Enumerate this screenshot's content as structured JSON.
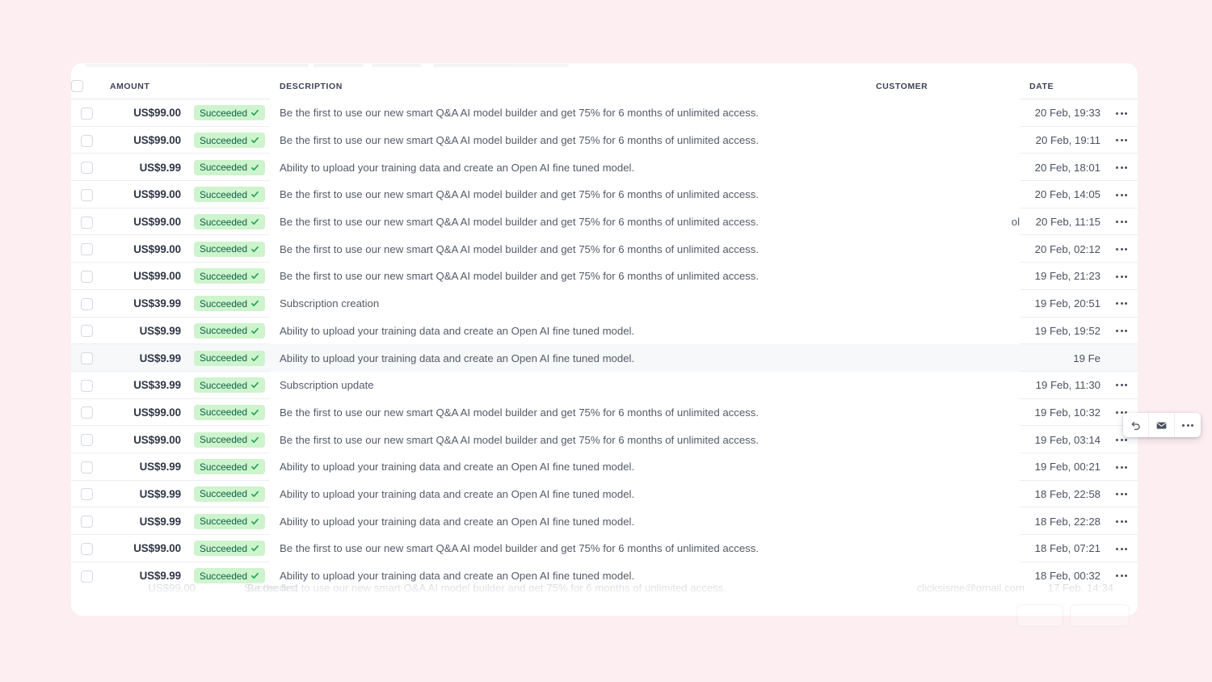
{
  "theme": {
    "page_background": "#fdeef2",
    "card_background": "#ffffff",
    "badge_background": "#cdf4cd",
    "badge_text": "#0e6245",
    "row_hover": "#f6f8f9",
    "divider": "#ebeef1"
  },
  "table": {
    "columns": {
      "select": "",
      "amount": "AMOUNT",
      "status": "",
      "description": "DESCRIPTION",
      "customer": "CUSTOMER",
      "date": "DATE",
      "actions": ""
    },
    "status_label": "Succeeded",
    "rows": [
      {
        "amount": "US$99.00",
        "status": "Succeeded",
        "description": "Be the first to use our new smart Q&A AI model builder and get 75% for 6 months of unlimited access.",
        "customer": "",
        "date": "20 Feb, 19:33",
        "hover": false
      },
      {
        "amount": "US$99.00",
        "status": "Succeeded",
        "description": "Be the first to use our new smart Q&A AI model builder and get 75% for 6 months of unlimited access.",
        "customer": "",
        "date": "20 Feb, 19:11",
        "hover": false
      },
      {
        "amount": "US$9.99",
        "status": "Succeeded",
        "description": "Ability to upload your training data and create an Open AI fine tuned model.",
        "customer": "",
        "date": "20 Feb, 18:01",
        "hover": false
      },
      {
        "amount": "US$99.00",
        "status": "Succeeded",
        "description": "Be the first to use our new smart Q&A AI model builder and get 75% for 6 months of unlimited access.",
        "customer": "",
        "date": "20 Feb, 14:05",
        "hover": false
      },
      {
        "amount": "US$99.00",
        "status": "Succeeded",
        "description": "Be the first to use our new smart Q&A AI model builder and get 75% for 6 months of unlimited access.",
        "customer": "ol",
        "date": "20 Feb, 11:15",
        "hover": false
      },
      {
        "amount": "US$99.00",
        "status": "Succeeded",
        "description": "Be the first to use our new smart Q&A AI model builder and get 75% for 6 months of unlimited access.",
        "customer": "",
        "date": "20 Feb, 02:12",
        "hover": false
      },
      {
        "amount": "US$99.00",
        "status": "Succeeded",
        "description": "Be the first to use our new smart Q&A AI model builder and get 75% for 6 months of unlimited access.",
        "customer": "",
        "date": "19 Feb, 21:23",
        "hover": false
      },
      {
        "amount": "US$39.99",
        "status": "Succeeded",
        "description": "Subscription creation",
        "customer": "",
        "date": "19 Feb, 20:51",
        "hover": false
      },
      {
        "amount": "US$9.99",
        "status": "Succeeded",
        "description": "Ability to upload your training data and create an Open AI fine tuned model.",
        "customer": "",
        "date": "19 Feb, 19:52",
        "hover": false
      },
      {
        "amount": "US$9.99",
        "status": "Succeeded",
        "description": "Ability to upload your training data and create an Open AI fine tuned model.",
        "customer": "",
        "date": "19 Fe",
        "hover": true
      },
      {
        "amount": "US$39.99",
        "status": "Succeeded",
        "description": "Subscription update",
        "customer": "",
        "date": "19 Feb, 11:30",
        "hover": false
      },
      {
        "amount": "US$99.00",
        "status": "Succeeded",
        "description": "Be the first to use our new smart Q&A AI model builder and get 75% for 6 months of unlimited access.",
        "customer": "",
        "date": "19 Feb, 10:32",
        "hover": false
      },
      {
        "amount": "US$99.00",
        "status": "Succeeded",
        "description": "Be the first to use our new smart Q&A AI model builder and get 75% for 6 months of unlimited access.",
        "customer": "",
        "date": "19 Feb, 03:14",
        "hover": false
      },
      {
        "amount": "US$9.99",
        "status": "Succeeded",
        "description": "Ability to upload your training data and create an Open AI fine tuned model.",
        "customer": "",
        "date": "19 Feb, 00:21",
        "hover": false
      },
      {
        "amount": "US$9.99",
        "status": "Succeeded",
        "description": "Ability to upload your training data and create an Open AI fine tuned model.",
        "customer": "",
        "date": "18 Feb, 22:58",
        "hover": false
      },
      {
        "amount": "US$9.99",
        "status": "Succeeded",
        "description": "Ability to upload your training data and create an Open AI fine tuned model.",
        "customer": "",
        "date": "18 Feb, 22:28",
        "hover": false
      },
      {
        "amount": "US$99.00",
        "status": "Succeeded",
        "description": "Be the first to use our new smart Q&A AI model builder and get 75% for 6 months of unlimited access.",
        "customer": "",
        "date": "18 Feb, 07:21",
        "hover": false
      },
      {
        "amount": "US$9.99",
        "status": "Succeeded",
        "description": "Ability to upload your training data and create an Open AI fine tuned model.",
        "customer": "",
        "date": "18 Feb, 00:32",
        "hover": false
      }
    ],
    "clipped_row": {
      "amount": "US$99.00",
      "status": "Succeeded",
      "description": "Be the first to use our new smart Q&A AI model builder and get 75% for 6 months of unlimited access.",
      "customer": "clicksisme@gmail.com",
      "date": "17 Feb, 14:34"
    }
  },
  "row_actions": {
    "refund_icon": "undo-arrow-icon",
    "email_icon": "envelope-icon",
    "more_icon": "ellipsis-icon"
  }
}
